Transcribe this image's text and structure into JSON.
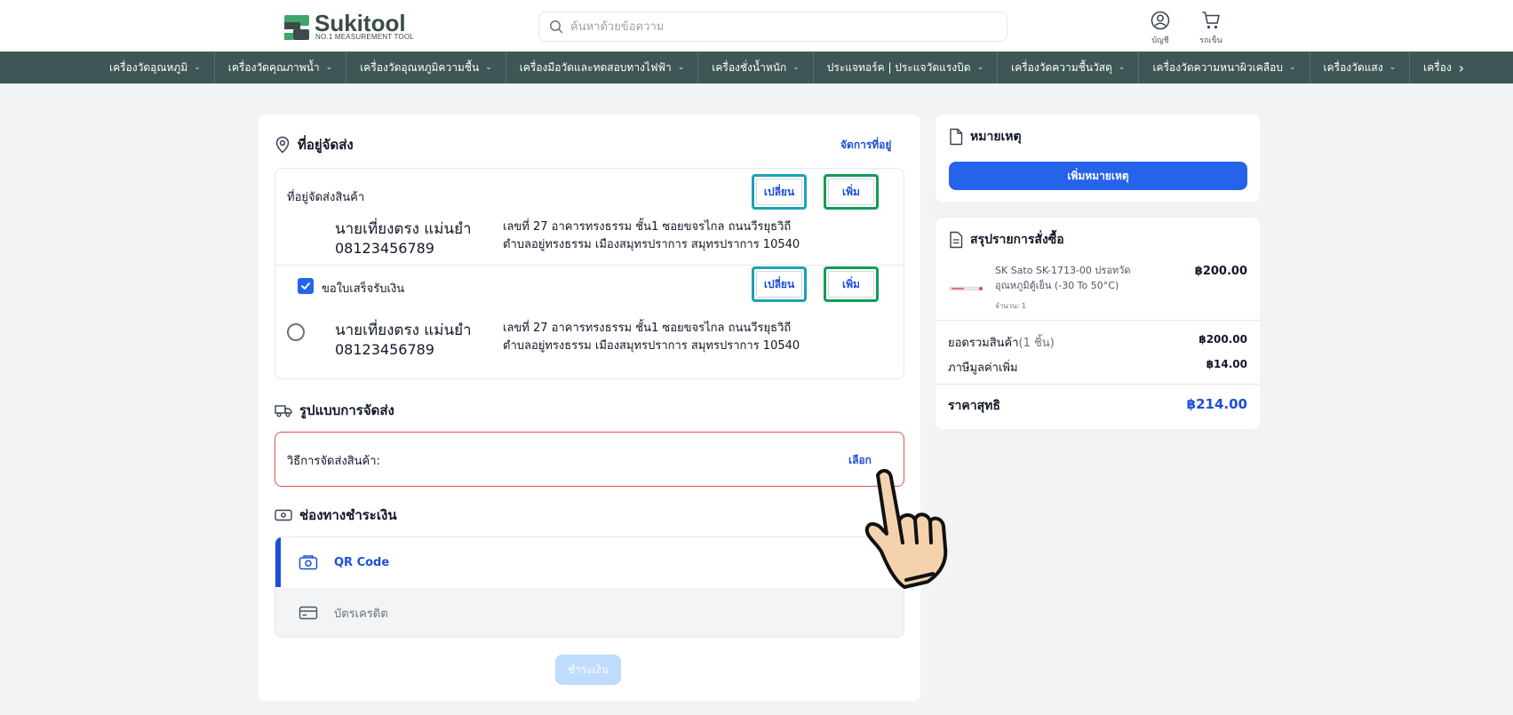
{
  "header": {
    "logo_name": "Sukitool",
    "logo_tagline": "NO.1 MEASUREMENT TOOL",
    "search_placeholder": "ค้นหาด้วยข้อความ",
    "account_label": "บัญชี",
    "cart_label": "รถเข็น"
  },
  "categories": [
    "เครื่องวัดอุณหภูมิ",
    "เครื่องวัดคุณภาพน้ำ",
    "เครื่องวัดอุณหภูมิความชื้น",
    "เครื่องมือวัดและทดสอบทางไฟฟ้า",
    "เครื่องชั่งน้ำหนัก",
    "ประแจทอร์ค | ประแจวัดแรงบิด",
    "เครื่องวัดความชื้นวัสดุ",
    "เครื่องวัดความหนาผิวเคลือบ",
    "เครื่องวัดแสง",
    "เครื่อง"
  ],
  "shipping_address": {
    "title": "ที่อยู่จัดส่ง",
    "manage_link": "จัดการที่อยู่",
    "label": "ที่อยู่จัดส่งสินค้า",
    "change_label": "เปลี่ยน",
    "add_label": "เพิ่ม",
    "name": "นายเที่ยงตรง  แม่นยำ",
    "phone": "08123456789",
    "address_line1": "เลขที่ 27 อาคารทรงธรรม ชั้น1 ซอยขจรไกล ถนนวีรยุธวิถี",
    "address_line2": "ตำบลอยู่ทรงธรรม เมืองสมุทรปราการ สมุทรปราการ 10540"
  },
  "invoice_address": {
    "checkbox_label": "ขอใบเสร็จรับเงิน",
    "checked": true,
    "change_label": "เปลี่ยน",
    "add_label": "เพิ่ม",
    "name": "นายเที่ยงตรง  แม่นยำ",
    "phone": "08123456789",
    "address_line1": "เลขที่ 27 อาคารทรงธรรม ชั้น1 ซอยขจรไกล ถนนวีรยุธวิถี",
    "address_line2": "ตำบลอยู่ทรงธรรม เมืองสมุทรปราการ สมุทรปราการ 10540"
  },
  "shipping_method": {
    "title": "รูปแบบการจัดส่ง",
    "label": "วิธีการจัดส่งสินค้า:",
    "select_link": "เลือก"
  },
  "payment": {
    "title": "ช่องทางชำระเงิน",
    "options": [
      "QR Code",
      "บัตรเครดิต"
    ],
    "selected": "QR Code",
    "pay_button": "ชำระเงิน"
  },
  "notes": {
    "title": "หมายเหตุ",
    "add_button": "เพิ่มหมายเหตุ"
  },
  "order_summary": {
    "title": "สรุปรายการสั่งซื้อ",
    "product_name": "SK Sato SK-1713-00 ปรอทวัดอุณหภูมิตู้เย็น (-30 To 50°C)",
    "product_qty": "จำนวน: 1",
    "product_price": "฿200.00",
    "subtotal_label": "ยอดรวมสินค้า",
    "subtotal_count": "(1 ชิ้น)",
    "subtotal_value": "฿200.00",
    "vat_label": "ภาษีมูลค่าเพิ่ม",
    "vat_value": "฿14.00",
    "total_label": "ราคาสุทธิ",
    "total_value": "฿214.00"
  },
  "colors": {
    "nav_bg": "#3f5656",
    "primary": "#2563eb",
    "highlight_teal": "#1aa3b4",
    "highlight_green": "#0f9d58",
    "error_border": "#e05252"
  }
}
